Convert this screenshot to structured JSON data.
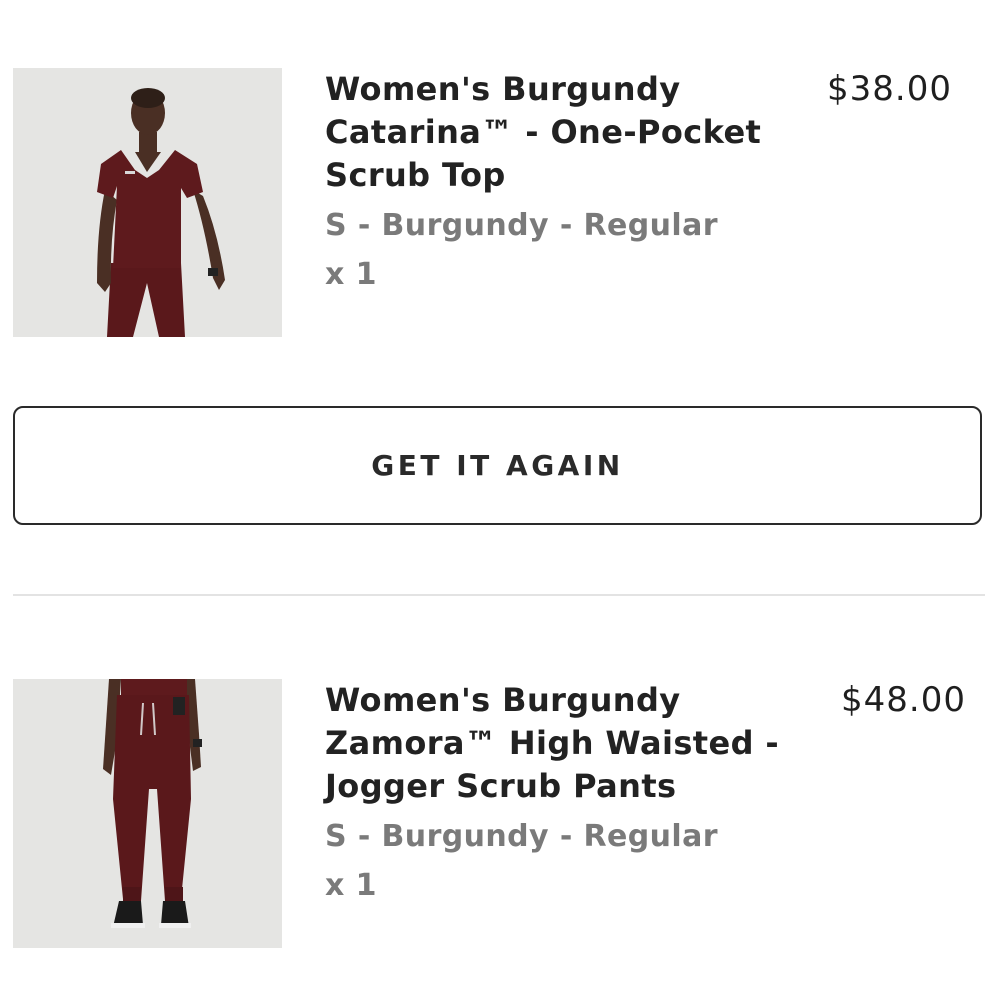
{
  "items": [
    {
      "title_lines": [
        "Women's Burgundy",
        "Catarina™ - One-Pocket",
        "Scrub Top"
      ],
      "variant": "S - Burgundy - Regular",
      "quantity": "x 1",
      "price": "$38.00",
      "image_icon": "scrub-top-model-photo"
    },
    {
      "title_lines": [
        "Women's Burgundy",
        "Zamora™ High Waisted -",
        "Jogger Scrub Pants"
      ],
      "variant": "S - Burgundy - Regular",
      "quantity": "x 1",
      "price": "$48.00",
      "image_icon": "jogger-pants-model-photo"
    }
  ],
  "cta": {
    "label": "GET IT AGAIN"
  },
  "colors": {
    "burgundy": "#5e1a1d",
    "thumb_bg": "#e5e5e3",
    "text_primary": "#222222",
    "text_secondary": "#7a7a7a",
    "border": "#2a2a2a",
    "divider": "#e3e3e3"
  }
}
